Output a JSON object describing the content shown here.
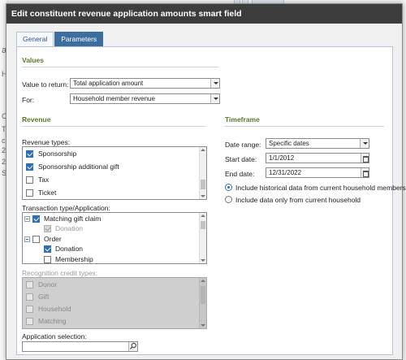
{
  "dialog": {
    "title": "Edit constituent revenue application amounts smart field"
  },
  "tabs": [
    {
      "label": "General",
      "active": false
    },
    {
      "label": "Parameters",
      "active": true
    }
  ],
  "values_section": {
    "title": "Values",
    "value_to_return_label": "Value to return:",
    "value_to_return": "Total application amount",
    "for_label": "For:",
    "for_value": "Household member revenue"
  },
  "revenue_section": {
    "title": "Revenue",
    "revenue_types_label": "Revenue types:",
    "revenue_types": [
      {
        "label": "Sponsorship",
        "checked": true
      },
      {
        "label": "Sponsorship additional gift",
        "checked": true
      },
      {
        "label": "Tax",
        "checked": false
      },
      {
        "label": "Ticket",
        "checked": false
      }
    ],
    "transaction_label": "Transaction type/Application:",
    "transaction_tree": [
      {
        "label": "Matching gift claim",
        "checked": true,
        "level": 0,
        "expanded": true
      },
      {
        "label": "Donation",
        "checked": true,
        "level": 1,
        "disabled": true
      },
      {
        "label": "Order",
        "checked": false,
        "level": 0,
        "expanded": true
      },
      {
        "label": "Donation",
        "checked": true,
        "level": 1
      },
      {
        "label": "Membership",
        "checked": false,
        "level": 1
      }
    ],
    "recognition_label": "Recognition credit types:",
    "recognition_types": [
      {
        "label": "Donor"
      },
      {
        "label": "Gift"
      },
      {
        "label": "Household"
      },
      {
        "label": "Matching"
      }
    ],
    "application_selection_label": "Application selection:",
    "application_selection_value": ""
  },
  "timeframe_section": {
    "title": "Timeframe",
    "date_range_label": "Date range:",
    "date_range": "Specific dates",
    "start_date_label": "Start date:",
    "start_date": "1/1/2012",
    "end_date_label": "End date:",
    "end_date": "12/31/2022",
    "option_include_historical": "Include historical data from current household members",
    "option_current_only": "Include data only from current household",
    "selected_option": "include_historical"
  },
  "background": {
    "fragments": [
      "a",
      "H",
      "C",
      "T",
      "c",
      "2",
      "2",
      "S"
    ]
  },
  "colors": {
    "title_bar": "#3d3d3d",
    "active_tab": "#3c6ea0",
    "section_title": "#5a7a2a",
    "checkbox_checked": "#2f6fba"
  }
}
